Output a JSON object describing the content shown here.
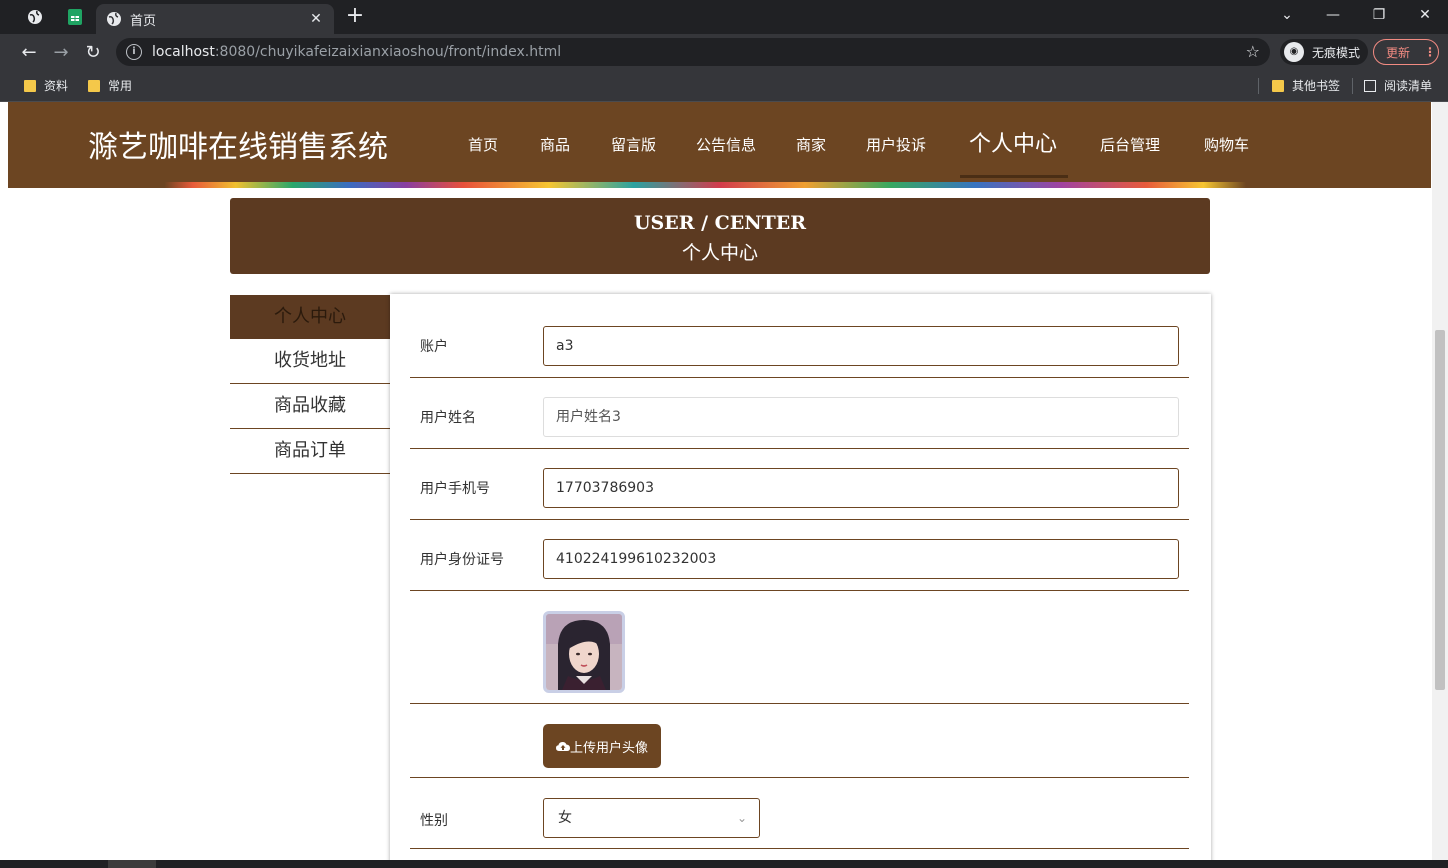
{
  "browser": {
    "tab_title": "首页",
    "url_host": "localhost",
    "url_rest": ":8080/chuyikafeizaixianxiaoshou/front/index.html",
    "incognito_label": "无痕模式",
    "update_label": "更新",
    "bookmarks": [
      "资料",
      "常用"
    ],
    "bookmarks_right": [
      "其他书签",
      "阅读清单"
    ]
  },
  "site": {
    "title": "滁艺咖啡在线销售系统",
    "nav": [
      "首页",
      "商品",
      "留言版",
      "公告信息",
      "商家",
      "用户投诉",
      "个人中心",
      "后台管理",
      "购物车"
    ],
    "active_nav": "个人中心"
  },
  "banner": {
    "en": "USER / CENTER",
    "zh": "个人中心"
  },
  "side_menu": [
    "个人中心",
    "收货地址",
    "商品收藏",
    "商品订单"
  ],
  "form": {
    "account_label": "账户",
    "account_value": "a3",
    "name_label": "用户姓名",
    "name_value": "用户姓名3",
    "phone_label": "用户手机号",
    "phone_value": "17703786903",
    "idcard_label": "用户身份证号",
    "idcard_value": "410224199610232003",
    "upload_label": "上传用户头像",
    "gender_label": "性别",
    "gender_value": "女"
  },
  "colors": {
    "header_bg": "#6c4522",
    "banner_bg": "#5c3a21",
    "accent": "#6c4522"
  }
}
